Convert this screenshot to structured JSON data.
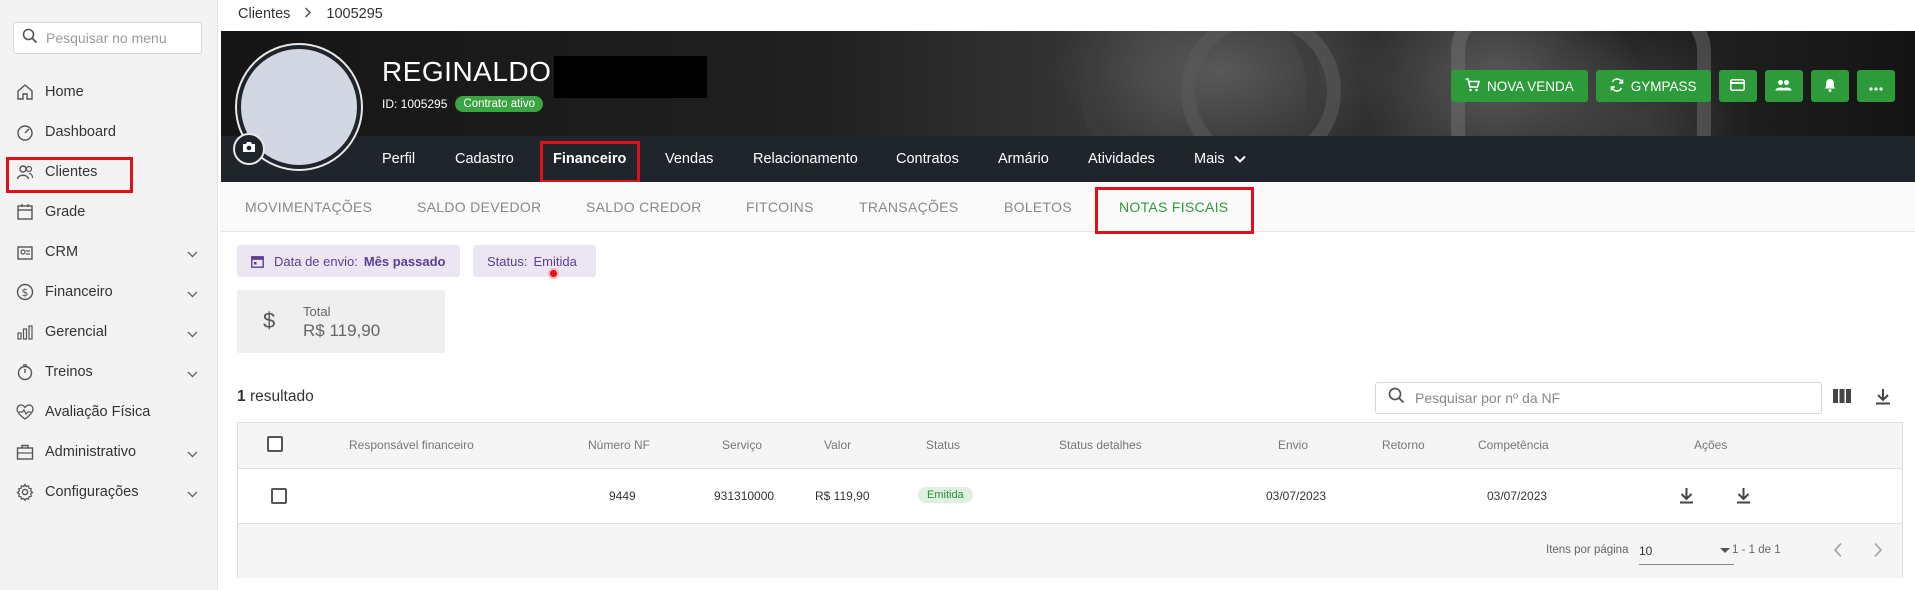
{
  "sidebar": {
    "search_placeholder": "Pesquisar no menu",
    "items": [
      {
        "label": "Home",
        "icon": "home-icon"
      },
      {
        "label": "Dashboard",
        "icon": "dashboard-icon"
      },
      {
        "label": "Clientes",
        "icon": "users-icon",
        "active": true
      },
      {
        "label": "Grade",
        "icon": "calendar-icon"
      },
      {
        "label": "CRM",
        "icon": "crm-icon",
        "has_submenu": true
      },
      {
        "label": "Financeiro",
        "icon": "dollar-icon",
        "has_submenu": true
      },
      {
        "label": "Gerencial",
        "icon": "bar-chart-icon",
        "has_submenu": true
      },
      {
        "label": "Treinos",
        "icon": "timer-icon",
        "has_submenu": true
      },
      {
        "label": "Avaliação Física",
        "icon": "heart-pulse-icon"
      },
      {
        "label": "Administrativo",
        "icon": "briefcase-icon",
        "has_submenu": true
      },
      {
        "label": "Configurações",
        "icon": "gear-icon",
        "has_submenu": true
      }
    ]
  },
  "breadcrumb": {
    "parent": "Clientes",
    "current": "1005295"
  },
  "client": {
    "name": "REGINALDO",
    "id_label": "ID: 1005295",
    "contract_badge": "Contrato ativo"
  },
  "actions": {
    "nova_venda": "NOVA VENDA",
    "gympass": "GYMPASS"
  },
  "client_menu": [
    "Perfil",
    "Cadastro",
    "Financeiro",
    "Vendas",
    "Relacionamento",
    "Contratos",
    "Armário",
    "Atividades",
    "Mais"
  ],
  "client_menu_active": "Financeiro",
  "tabs": [
    "MOVIMENTAÇÕES",
    "SALDO DEVEDOR",
    "SALDO CREDOR",
    "FITCOINS",
    "TRANSAÇÕES",
    "BOLETOS",
    "NOTAS FISCAIS"
  ],
  "active_tab": "NOTAS FISCAIS",
  "filters": {
    "date_label": "Data de envio:",
    "date_value": "Mês passado",
    "status_label": "Status:",
    "status_value": "Emitida"
  },
  "total": {
    "label": "Total",
    "value": "R$ 119,90"
  },
  "results": {
    "count": "1",
    "label": "resultado"
  },
  "nf_search_placeholder": "Pesquisar por nº da NF",
  "table": {
    "headers": [
      "Responsável financeiro",
      "Número NF",
      "Serviço",
      "Valor",
      "Status",
      "Status detalhes",
      "Envio",
      "Retorno",
      "Competência",
      "Ações"
    ],
    "rows": [
      {
        "responsavel": "",
        "numero": "9449",
        "servico": "931310000",
        "valor": "R$ 119,90",
        "status": "Emitida",
        "status_detalhes": "",
        "envio": "03/07/2023",
        "retorno": "",
        "competencia": "03/07/2023"
      }
    ],
    "footer": {
      "per_page_label": "Itens por página",
      "per_page_value": "10",
      "range": "1 - 1 de 1"
    }
  },
  "colors": {
    "accent_green": "#2e9b3a",
    "highlight_red": "#e0101b",
    "chip_purple": "#5b3f93"
  }
}
